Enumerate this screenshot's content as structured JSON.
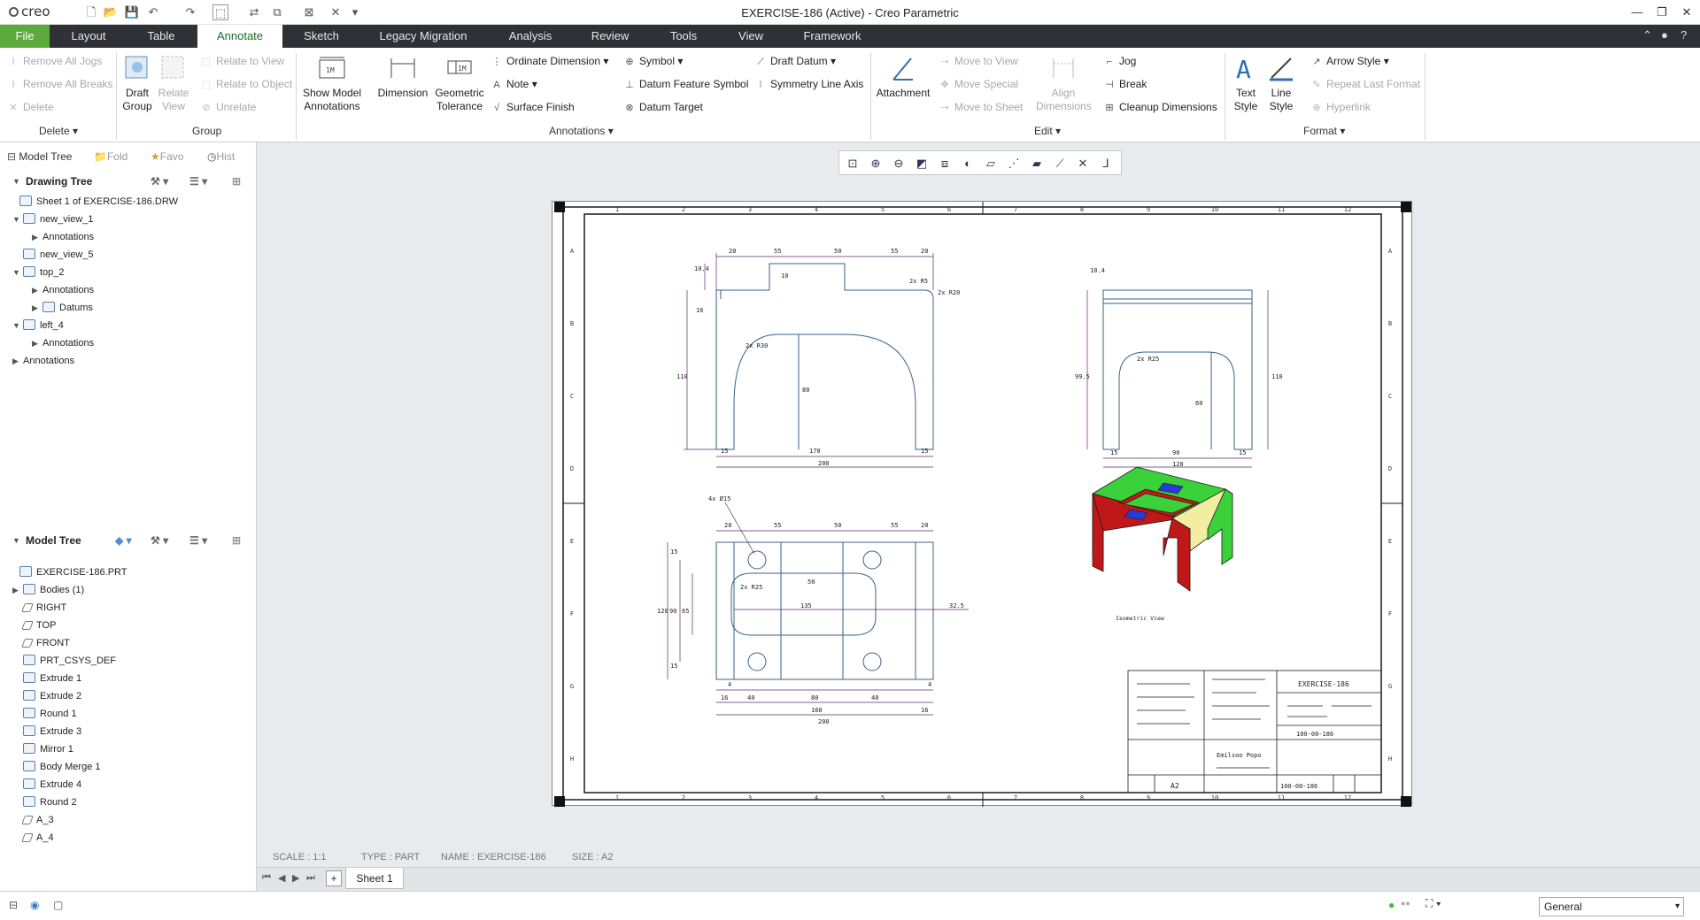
{
  "window": {
    "title": "EXERCISE-186 (Active) - Creo Parametric",
    "app_name": "creo"
  },
  "menu_tabs": [
    "File",
    "Layout",
    "Table",
    "Annotate",
    "Sketch",
    "Legacy Migration",
    "Analysis",
    "Review",
    "Tools",
    "View",
    "Framework"
  ],
  "ribbon": {
    "delete_group": {
      "items": [
        "Remove All Jogs",
        "Remove All Breaks",
        "Delete"
      ],
      "label": "Delete"
    },
    "group_group": {
      "draft_group": "Draft Group",
      "relate_view": "Relate View",
      "relate_to_view": "Relate to View",
      "relate_to_object": "Relate to Object",
      "unrelate": "Unrelate",
      "label": "Group"
    },
    "annotations_group": {
      "show_model": "Show Model Annotations",
      "dimension": "Dimension",
      "geometric_tolerance": "Geometric Tolerance",
      "ordinate": "Ordinate Dimension",
      "note": "Note",
      "surface_finish": "Surface Finish",
      "symbol": "Symbol",
      "datum_feature_symbol": "Datum Feature Symbol",
      "datum_target": "Datum Target",
      "draft_datum": "Draft Datum",
      "symmetry_line_axis": "Symmetry Line Axis",
      "label": "Annotations"
    },
    "edit_group": {
      "attachment": "Attachment",
      "move_to_view": "Move to View",
      "move_special": "Move Special",
      "move_to_sheet": "Move to Sheet",
      "align_dimensions": "Align Dimensions",
      "jog": "Jog",
      "break": "Break",
      "cleanup_dimensions": "Cleanup Dimensions",
      "label": "Edit"
    },
    "format_group": {
      "text_style": "Text Style",
      "line_style": "Line Style",
      "arrow_style": "Arrow Style",
      "repeat_last_format": "Repeat Last Format",
      "hyperlink": "Hyperlink",
      "label": "Format"
    }
  },
  "panel_tabs": [
    "Model Tree",
    "Fold",
    "Favo",
    "Hist"
  ],
  "drawing_tree": {
    "header": "Drawing Tree",
    "rows": [
      "Sheet 1 of EXERCISE-186.DRW",
      "new_view_1",
      "Annotations",
      "new_view_5",
      "top_2",
      "Annotations",
      "Datums",
      "left_4",
      "Annotations",
      "Annotations"
    ]
  },
  "model_tree": {
    "header": "Model Tree",
    "rows": [
      "EXERCISE-186.PRT",
      "Bodies (1)",
      "RIGHT",
      "TOP",
      "FRONT",
      "PRT_CSYS_DEF",
      "Extrude 1",
      "Extrude 2",
      "Round 1",
      "Extrude 3",
      "Mirror 1",
      "Body Merge 1",
      "Extrude 4",
      "Round 2",
      "A_3",
      "A_4"
    ]
  },
  "drawing": {
    "iso_label": "Isometric View",
    "title_block": {
      "name": "EXERCISE-186",
      "size": "A2",
      "number": "100-00-186",
      "company": "Emilsoo Popo"
    },
    "front_dims": [
      "20",
      "55",
      "50",
      "55",
      "20",
      "10.4",
      "16",
      "110",
      "170",
      "200",
      "15",
      "15",
      "80",
      "10",
      "2x R5",
      "2x R20",
      "2x R30"
    ],
    "side_dims": [
      "10.4",
      "99.5",
      "110",
      "90",
      "120",
      "15",
      "15",
      "60",
      "2x R25"
    ],
    "top_dims": [
      "20",
      "55",
      "50",
      "55",
      "20",
      "4x Ø15",
      "15",
      "120",
      "90",
      "65",
      "135",
      "32.5",
      "50",
      "2x R25",
      "4",
      "16",
      "40",
      "80",
      "40",
      "16",
      "160",
      "200",
      "4",
      "15"
    ],
    "border_cols": [
      "1",
      "2",
      "3",
      "4",
      "5",
      "6",
      "7",
      "8",
      "9",
      "10",
      "11",
      "12"
    ],
    "border_rows": [
      "A",
      "B",
      "C",
      "D",
      "E",
      "F",
      "G",
      "H"
    ]
  },
  "status": {
    "scale": "SCALE : 1:1",
    "type": "TYPE : PART",
    "name": "NAME : EXERCISE-186",
    "size": "SIZE : A2"
  },
  "sheet_tab": "Sheet 1",
  "filter_select": "General"
}
